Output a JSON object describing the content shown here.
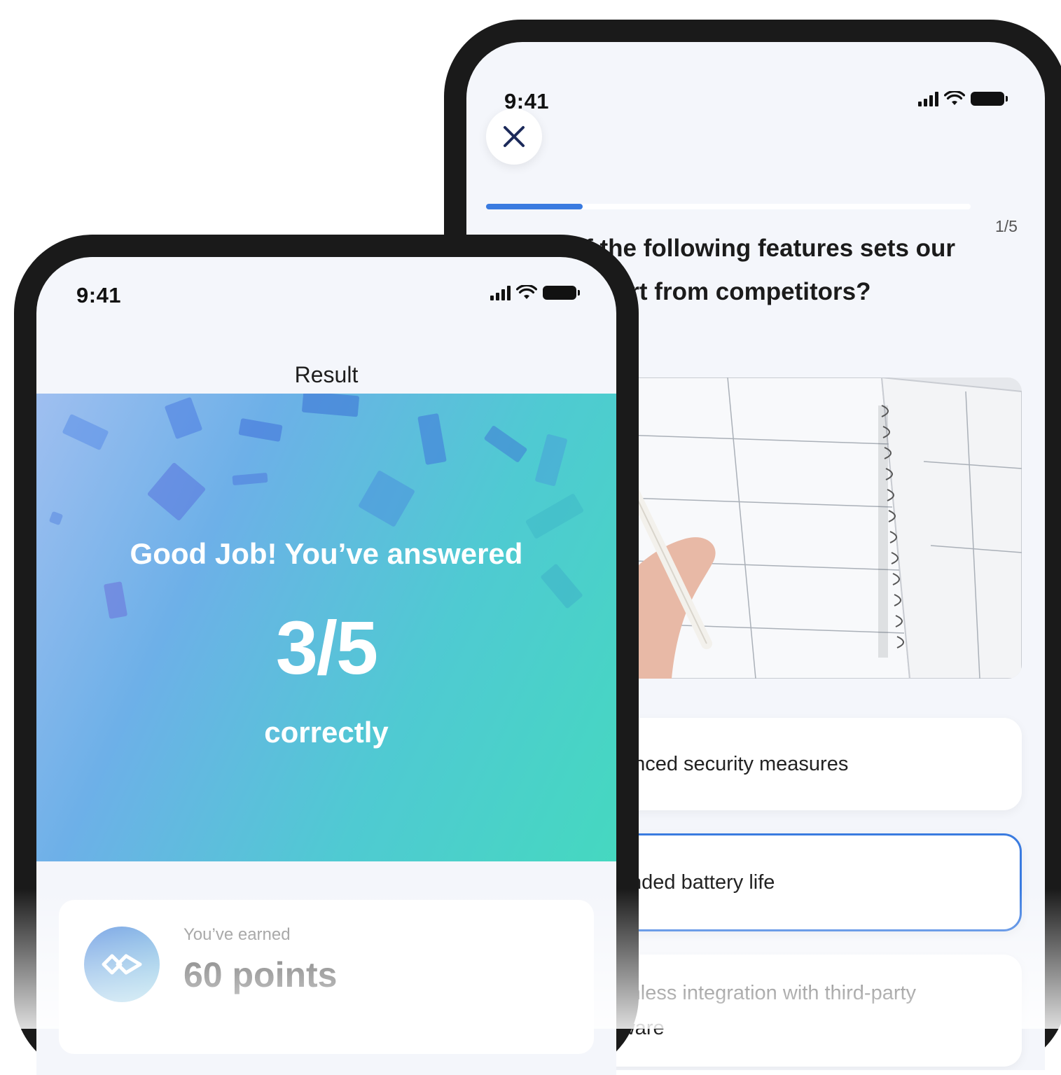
{
  "quiz_screen": {
    "status_time": "9:41",
    "close_icon": "close-icon",
    "progress_fraction": 0.2,
    "progress_text": "1/5",
    "question": "Which of the following features sets our product apart from competitors?",
    "image_icon": "planner-notebook-photo",
    "options": [
      {
        "label": "Advanced security measures",
        "selected": false
      },
      {
        "label": "Extended battery life",
        "selected": true
      },
      {
        "label": "Seamless integration with third-party software",
        "selected": false
      }
    ],
    "accent_color": "#3a7be0"
  },
  "result_screen": {
    "status_time": "9:41",
    "title": "Result",
    "hero": {
      "line1": "Good Job! You’ve answered",
      "score": "3/5",
      "line3": "correctly"
    },
    "points": {
      "label": "You’ve earned",
      "value": "60 points",
      "icon": "points-diamond-icon"
    }
  }
}
